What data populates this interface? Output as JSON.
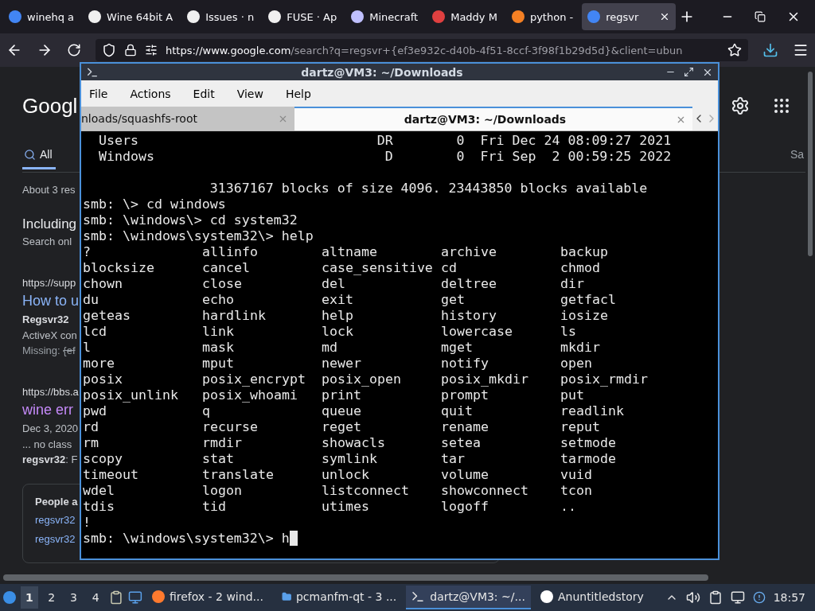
{
  "browser": {
    "tabs": [
      {
        "label": "winehq a",
        "selected": false
      },
      {
        "label": "Wine 64bit A",
        "selected": false
      },
      {
        "label": "Issues · n",
        "selected": false
      },
      {
        "label": "FUSE · Ap",
        "selected": false
      },
      {
        "label": "Minecraft",
        "selected": false
      },
      {
        "label": "Maddy M",
        "selected": false
      },
      {
        "label": "python -",
        "selected": false
      },
      {
        "label": "regsvr",
        "selected": true
      }
    ],
    "url_host": "https://www.google.com",
    "url_rest": "/search?q=regsvr+{ef3e932c-d40b-4f51-8ccf-3f98f1b29d5d}&client=ubun"
  },
  "google": {
    "logo": "Googl",
    "search_tab": "All",
    "side_tab": "Sa",
    "about": "About 3 res",
    "including": "Including",
    "search_only": "Search onl",
    "results": [
      {
        "url": "https://supp",
        "title": "How to u",
        "visited": false,
        "lines": [
          {
            "kind": "bold",
            "text": "Regsvr32"
          },
          {
            "kind": "plain",
            "text": "ActiveX con"
          }
        ],
        "missing_label": "Missing:",
        "missing_term": "{ef"
      },
      {
        "url": "https://bbs.a",
        "title": "wine err",
        "visited": true,
        "lines": [
          {
            "kind": "plain",
            "text": "Dec 3, 2020"
          },
          {
            "kind": "plain",
            "text": "... no class"
          },
          {
            "kind": "boldlead",
            "text": "regsvr32",
            "rest": ": F"
          }
        ]
      }
    ],
    "people_title": "People a",
    "people_links": [
      "regsvr32",
      "regsvr32"
    ]
  },
  "terminal": {
    "title": "dartz@VM3: ~/Downloads",
    "menu": [
      "File",
      "Actions",
      "Edit",
      "View",
      "Help"
    ],
    "tabs": [
      {
        "label": "nloads/squashfs-root",
        "selected": false
      },
      {
        "label": "dartz@VM3: ~/Downloads",
        "selected": true
      }
    ],
    "listing": [
      "  Users                              DR        0  Fri Dec 24 08:09:27 2021",
      "  Windows                             D        0  Fri Sep  2 00:59:25 2022"
    ],
    "summary": "                31367167 blocks of size 4096. 23443850 blocks available",
    "commands": [
      "smb: \\> cd windows",
      "smb: \\windows\\> cd system32",
      "smb: \\windows\\system32\\> help"
    ],
    "help_table": [
      [
        "?",
        "allinfo",
        "altname",
        "archive",
        "backup"
      ],
      [
        "blocksize",
        "cancel",
        "case_sensitive",
        "cd",
        "chmod"
      ],
      [
        "chown",
        "close",
        "del",
        "deltree",
        "dir"
      ],
      [
        "du",
        "echo",
        "exit",
        "get",
        "getfacl"
      ],
      [
        "geteas",
        "hardlink",
        "help",
        "history",
        "iosize"
      ],
      [
        "lcd",
        "link",
        "lock",
        "lowercase",
        "ls"
      ],
      [
        "l",
        "mask",
        "md",
        "mget",
        "mkdir"
      ],
      [
        "more",
        "mput",
        "newer",
        "notify",
        "open"
      ],
      [
        "posix",
        "posix_encrypt",
        "posix_open",
        "posix_mkdir",
        "posix_rmdir"
      ],
      [
        "posix_unlink",
        "posix_whoami",
        "print",
        "prompt",
        "put"
      ],
      [
        "pwd",
        "q",
        "queue",
        "quit",
        "readlink"
      ],
      [
        "rd",
        "recurse",
        "reget",
        "rename",
        "reput"
      ],
      [
        "rm",
        "rmdir",
        "showacls",
        "setea",
        "setmode"
      ],
      [
        "scopy",
        "stat",
        "symlink",
        "tar",
        "tarmode"
      ],
      [
        "timeout",
        "translate",
        "unlock",
        "volume",
        "vuid"
      ],
      [
        "wdel",
        "logon",
        "listconnect",
        "showconnect",
        "tcon"
      ],
      [
        "tdis",
        "tid",
        "utimes",
        "logoff",
        ".."
      ],
      [
        "!"
      ]
    ],
    "prompt": "smb: \\windows\\system32\\> h"
  },
  "taskbar": {
    "workspaces": [
      {
        "label": "1",
        "selected": true
      },
      {
        "label": "2",
        "selected": false
      },
      {
        "label": "3",
        "selected": false
      },
      {
        "label": "4",
        "selected": false
      }
    ],
    "tasks": [
      {
        "kind": "firefox",
        "label": "firefox - 2 wind...",
        "selected": false
      },
      {
        "kind": "folder",
        "label": "pcmanfm-qt - 3 ...",
        "selected": false
      },
      {
        "kind": "terminal",
        "label": "dartz@VM3: ~/...",
        "selected": true
      },
      {
        "kind": "ghost",
        "label": "Anuntitledstory",
        "selected": false
      }
    ],
    "clock": "18:57"
  }
}
